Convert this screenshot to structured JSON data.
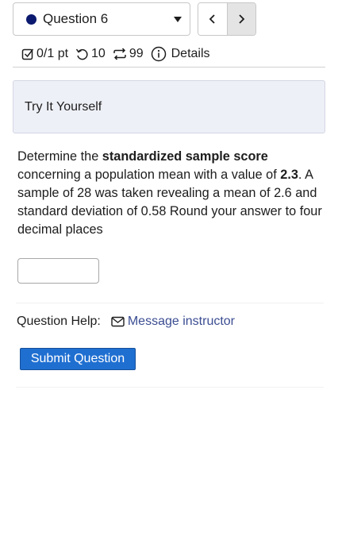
{
  "question_select": {
    "label": "Question 6"
  },
  "meta": {
    "score": "0/1 pt",
    "retries": "10",
    "attempts": "99",
    "details": "Details"
  },
  "try_it": "Try It Yourself",
  "question": {
    "p1": "Determine the ",
    "b1": "standardized sample score",
    "p2": " concerning a population mean with a value of ",
    "b2": "2.3",
    "p3": ". A sample of 28 was taken revealing a mean of 2.6 and standard deviation of 0.58 Round your answer to four decimal places"
  },
  "answer": {
    "value": ""
  },
  "help": {
    "label": "Question Help:",
    "message": "Message instructor"
  },
  "submit_label": "Submit Question",
  "colors": {
    "accent": "#1f6fd1",
    "link": "#3b4d92",
    "dot": "#0b1a6e"
  }
}
